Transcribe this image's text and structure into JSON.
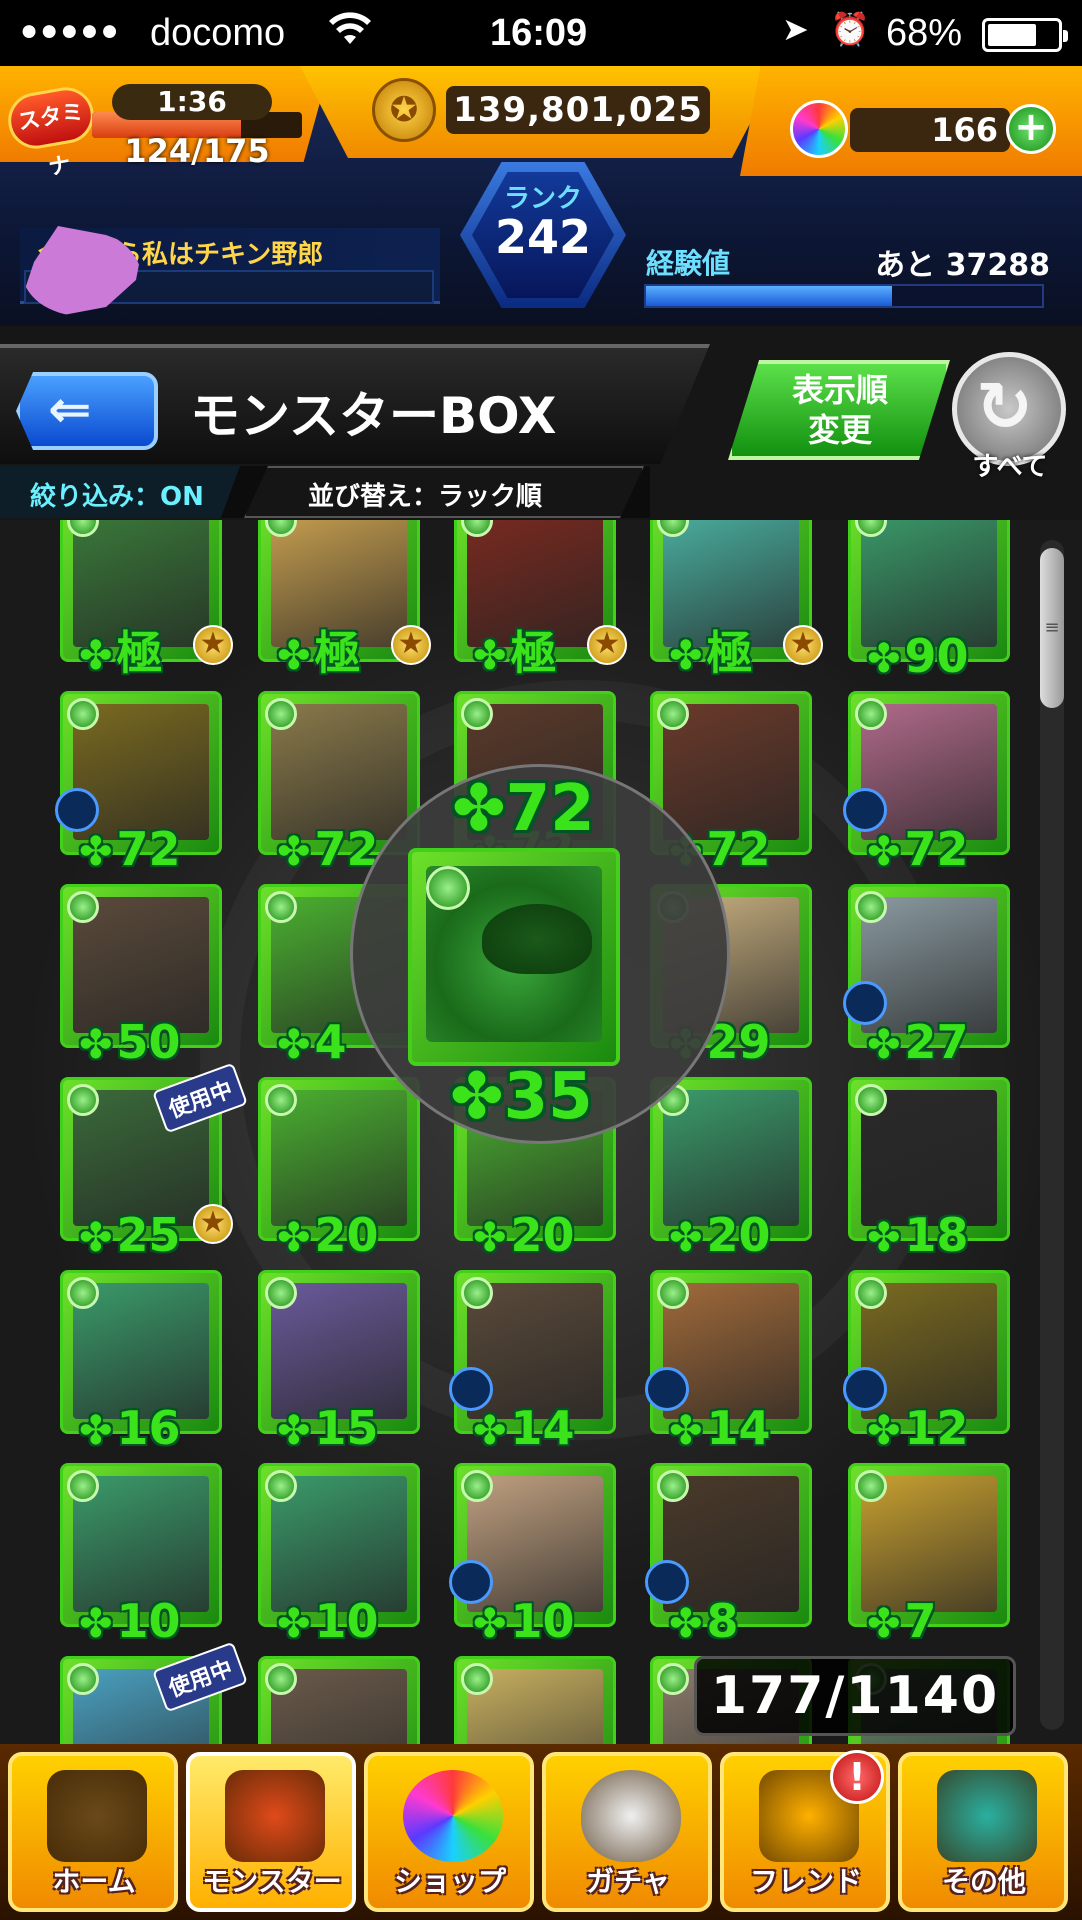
{
  "status_bar": {
    "signal": "●●●●●",
    "carrier": "docomo",
    "wifi_icon": "wifi-icon",
    "time": "16:09",
    "location_icon": "➤",
    "alarm_icon": "⏰",
    "battery": "68%"
  },
  "header": {
    "stamina_label": "スタミナ",
    "stamina_timer": "1:36",
    "stamina_value": "124/175",
    "stamina_fraction": 0.709,
    "gold_icon": "✪",
    "gold": "139,801,025",
    "orbs": "166",
    "orb_add": "+",
    "player_comment": "今日から私はチキン野郎",
    "rank_label": "ランク",
    "rank": "242",
    "exp_label": "経験値",
    "exp_remaining": "あと 37288",
    "exp_fraction": 0.62
  },
  "toolbar": {
    "back_icon": "⇐",
    "title": "モンスターBOX",
    "filter": "絞り込み：ON",
    "sort": "並び替え：ラック順",
    "order_button": "表示順\n変更",
    "all_icon": "↻",
    "all_button": "すべて"
  },
  "monsters": [
    {
      "level": "極",
      "star": true,
      "art": "#3a7a3a"
    },
    {
      "level": "極",
      "star": true,
      "art": "#c8a050"
    },
    {
      "level": "極",
      "star": true,
      "art": "#7a2a20"
    },
    {
      "level": "極",
      "star": true,
      "art": "#4ab0a0"
    },
    {
      "level": "90",
      "star": false,
      "art": "#3a9a6a"
    },
    {
      "level": "72",
      "star": false,
      "art": "#7a6a20",
      "ring": true
    },
    {
      "level": "72",
      "star": false,
      "art": "#8a7a4a"
    },
    {
      "level": "72",
      "star": false,
      "art": "#5a3a2a"
    },
    {
      "level": "72",
      "star": false,
      "art": "#6a3a2a"
    },
    {
      "level": "72",
      "star": false,
      "art": "#b06a8a",
      "ring": true
    },
    {
      "level": "50",
      "star": false,
      "art": "#5a4a3a"
    },
    {
      "level": "4",
      "star": false,
      "art": "#4ab030"
    },
    {
      "level": "35",
      "star": false,
      "art": "#2a8a2a"
    },
    {
      "level": "29",
      "star": false,
      "art": "#c8b080"
    },
    {
      "level": "27",
      "star": false,
      "art": "#8a9aa0",
      "ring": true
    },
    {
      "level": "25",
      "star": true,
      "art": "#3a6a3a",
      "badge": "使用中"
    },
    {
      "level": "20",
      "star": false,
      "art": "#4ab030"
    },
    {
      "level": "20",
      "star": false,
      "art": "#4ab030"
    },
    {
      "level": "20",
      "star": false,
      "art": "#3a9a6a"
    },
    {
      "level": "18",
      "star": false,
      "art": "#2a2a2a"
    },
    {
      "level": "16",
      "star": false,
      "art": "#3a9a6a"
    },
    {
      "level": "15",
      "star": false,
      "art": "#6a5a9a"
    },
    {
      "level": "14",
      "star": false,
      "art": "#5a4a3a",
      "ring": true
    },
    {
      "level": "14",
      "star": false,
      "art": "#a06a3a",
      "ring": true
    },
    {
      "level": "12",
      "star": false,
      "art": "#7a6a20",
      "ring": true
    },
    {
      "level": "10",
      "star": false,
      "art": "#3a9a6a"
    },
    {
      "level": "10",
      "star": false,
      "art": "#3a9a6a"
    },
    {
      "level": "10",
      "star": false,
      "art": "#c0a080",
      "ring": true
    },
    {
      "level": "8",
      "star": false,
      "art": "#4a3a2a",
      "ring": true
    },
    {
      "level": "7",
      "star": false,
      "art": "#c8a030"
    },
    {
      "level": "",
      "star": false,
      "art": "#4aa0c0",
      "badge": "使用中"
    },
    {
      "level": "",
      "star": false,
      "art": "#6a5a4a"
    },
    {
      "level": "",
      "star": false,
      "art": "#c8b060"
    },
    {
      "level": "",
      "star": false,
      "art": "#8a7a6a"
    },
    {
      "level": "",
      "star": false,
      "art": "#6a8a6a"
    }
  ],
  "zoom": {
    "top_level": "72",
    "bottom_level": "35"
  },
  "clover": "✤",
  "star_glyph": "★",
  "counter": "177/1140",
  "nav": [
    {
      "label": "ホーム",
      "icon": "home-icon",
      "color": "#6a4a1a"
    },
    {
      "label": "モンスター",
      "icon": "monster-icon",
      "color": "#e04a1a",
      "active": true
    },
    {
      "label": "ショップ",
      "icon": "orb-icon",
      "color": "#8a5aff"
    },
    {
      "label": "ガチャ",
      "icon": "egg-icon",
      "color": "#f0f0f0"
    },
    {
      "label": "フレンド",
      "icon": "friend-icon",
      "color": "#ffb000"
    },
    {
      "label": "その他",
      "icon": "other-icon",
      "color": "#2ab0a0"
    }
  ],
  "nav_alert": "!"
}
